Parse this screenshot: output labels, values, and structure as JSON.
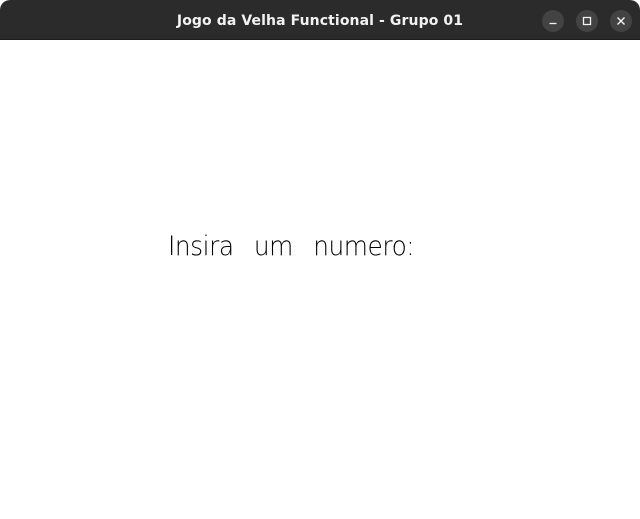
{
  "window": {
    "title": "Jogo da Velha Functional - Grupo 01",
    "controls": {
      "minimize_icon": "minimize-icon",
      "maximize_icon": "maximize-icon",
      "close_icon": "close-icon"
    },
    "colors": {
      "titlebar": "#2b2b2b",
      "button_bg": "#434343",
      "title_text": "#f2f2f2"
    }
  },
  "main": {
    "prompt": "Insira um numero:"
  }
}
